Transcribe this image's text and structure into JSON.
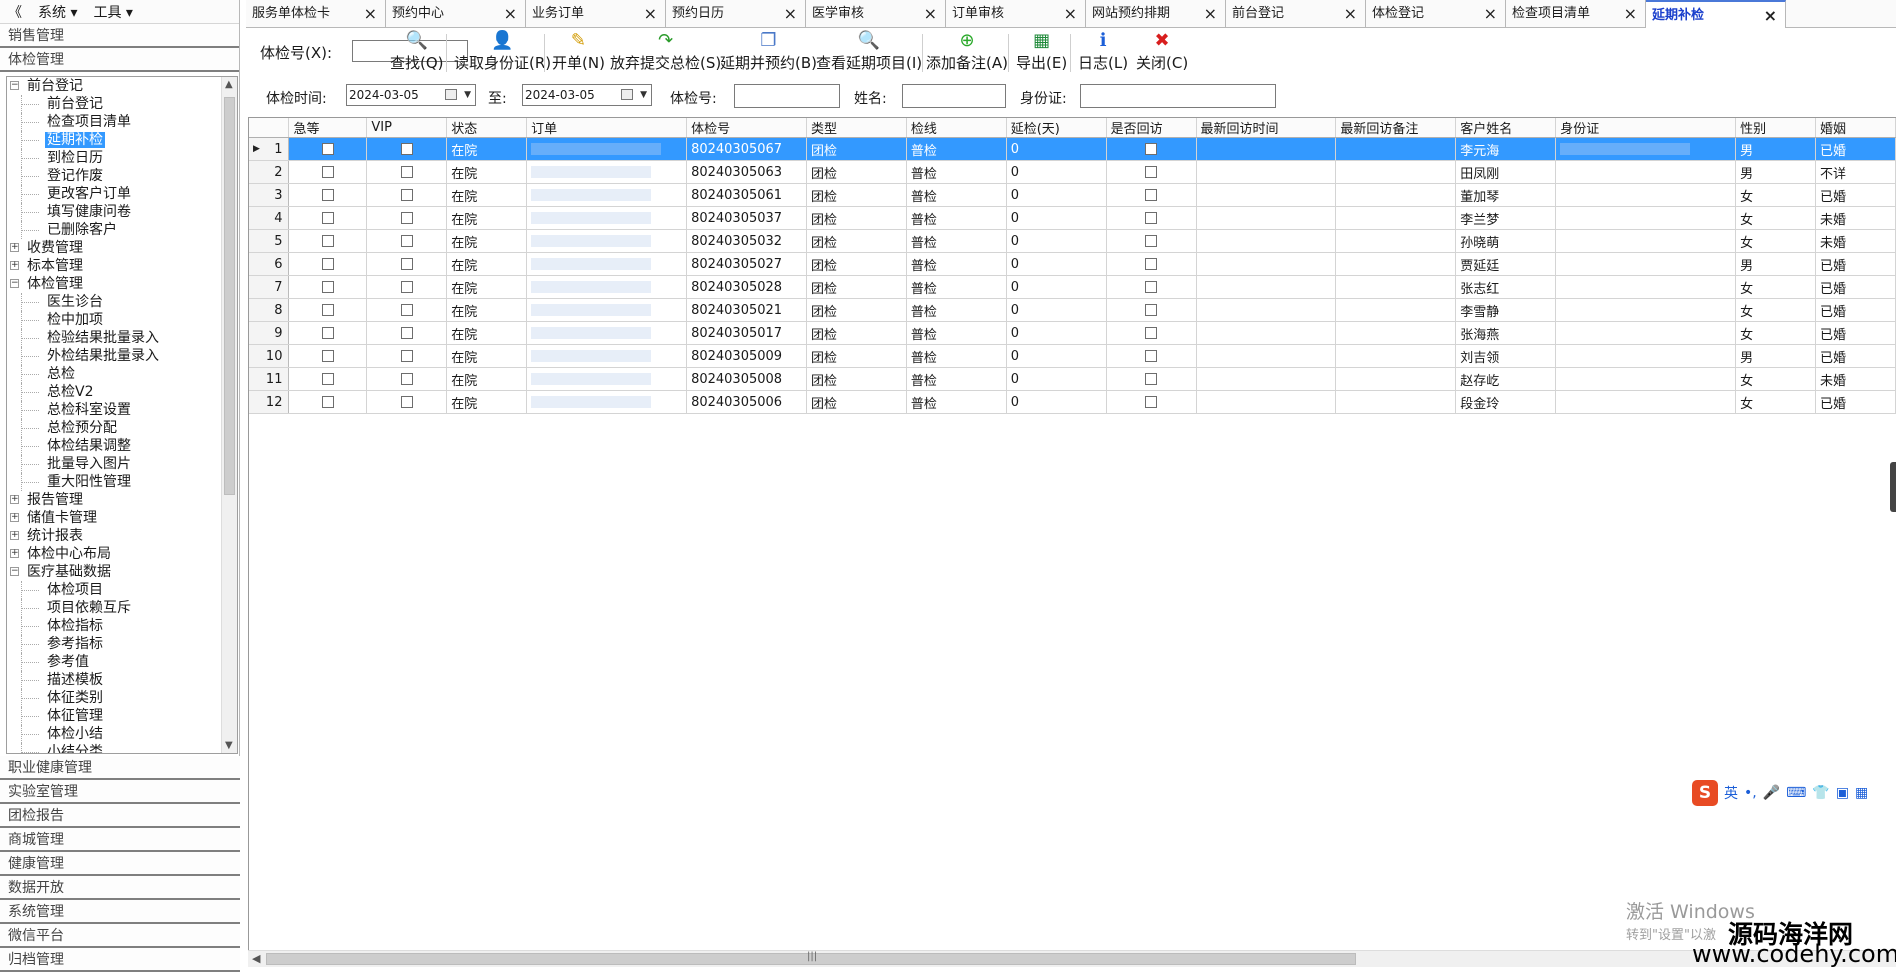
{
  "menu": {
    "collapse": "《",
    "system": "系统",
    "tools": "工具"
  },
  "left_nav": {
    "top_headers": [
      "销售管理",
      "体检管理"
    ],
    "tree": [
      {
        "label": "前台登记",
        "level": 1,
        "expander": "−"
      },
      {
        "label": "前台登记",
        "level": 2
      },
      {
        "label": "检查项目清单",
        "level": 2
      },
      {
        "label": "延期补检",
        "level": 2,
        "selected": true
      },
      {
        "label": "到检日历",
        "level": 2
      },
      {
        "label": "登记作废",
        "level": 2
      },
      {
        "label": "更改客户订单",
        "level": 2
      },
      {
        "label": "填写健康问卷",
        "level": 2
      },
      {
        "label": "已删除客户",
        "level": 2
      },
      {
        "label": "收费管理",
        "level": 1,
        "expander": "+"
      },
      {
        "label": "标本管理",
        "level": 1,
        "expander": "+"
      },
      {
        "label": "体检管理",
        "level": 1,
        "expander": "−"
      },
      {
        "label": "医生诊台",
        "level": 2
      },
      {
        "label": "检中加项",
        "level": 2
      },
      {
        "label": "检验结果批量录入",
        "level": 2
      },
      {
        "label": "外检结果批量录入",
        "level": 2
      },
      {
        "label": "总检",
        "level": 2
      },
      {
        "label": "总检V2",
        "level": 2
      },
      {
        "label": "总检科室设置",
        "level": 2
      },
      {
        "label": "总检预分配",
        "level": 2
      },
      {
        "label": "体检结果调整",
        "level": 2
      },
      {
        "label": "批量导入图片",
        "level": 2
      },
      {
        "label": "重大阳性管理",
        "level": 2
      },
      {
        "label": "报告管理",
        "level": 1,
        "expander": "+"
      },
      {
        "label": "储值卡管理",
        "level": 1,
        "expander": "+"
      },
      {
        "label": "统计报表",
        "level": 1,
        "expander": "+"
      },
      {
        "label": "体检中心布局",
        "level": 1,
        "expander": "+"
      },
      {
        "label": "医疗基础数据",
        "level": 1,
        "expander": "−"
      },
      {
        "label": "体检项目",
        "level": 2
      },
      {
        "label": "项目依赖互斥",
        "level": 2
      },
      {
        "label": "体检指标",
        "level": 2
      },
      {
        "label": "参考指标",
        "level": 2
      },
      {
        "label": "参考值",
        "level": 2
      },
      {
        "label": "描述模板",
        "level": 2
      },
      {
        "label": "体征类别",
        "level": 2
      },
      {
        "label": "体征管理",
        "level": 2
      },
      {
        "label": "体检小结",
        "level": 2
      },
      {
        "label": "小结分类",
        "level": 2
      }
    ],
    "bottom_headers": [
      "职业健康管理",
      "实验室管理",
      "团检报告",
      "商城管理",
      "健康管理",
      "数据开放",
      "系统管理",
      "微信平台",
      "归档管理"
    ]
  },
  "tabs": [
    {
      "label": "服务单体检卡"
    },
    {
      "label": "预约中心"
    },
    {
      "label": "业务订单"
    },
    {
      "label": "预约日历"
    },
    {
      "label": "医学审核"
    },
    {
      "label": "订单审核"
    },
    {
      "label": "网站预约排期"
    },
    {
      "label": "前台登记"
    },
    {
      "label": "体检登记"
    },
    {
      "label": "检查项目清单"
    },
    {
      "label": "延期补检",
      "active": true
    }
  ],
  "toolbar": {
    "search_label": "体检号(X):",
    "search_value": "",
    "buttons": [
      {
        "label": "查找(Q)",
        "icon": "magnifier-icon",
        "glyph": "🔍"
      },
      {
        "label": "读取身份证(R)",
        "icon": "id-card-reader-icon",
        "glyph": "👤"
      },
      {
        "label": "开单(N)",
        "icon": "edit-icon",
        "glyph": "✎"
      },
      {
        "label": "放弃提交总检(S)",
        "icon": "green-arrow-icon",
        "glyph": "↷"
      },
      {
        "label": "延期并预约(B)",
        "icon": "copy-icon",
        "glyph": "❐"
      },
      {
        "label": "查看延期项目(I)",
        "icon": "search-doc-icon",
        "glyph": "🔍"
      },
      {
        "label": "添加备注(A)",
        "icon": "green-plus-icon",
        "glyph": "⊕"
      },
      {
        "label": "导出(E)",
        "icon": "excel-icon",
        "glyph": "▦"
      },
      {
        "label": "日志(L)",
        "icon": "info-icon",
        "glyph": "ℹ"
      },
      {
        "label": "关闭(C)",
        "icon": "red-x-icon",
        "glyph": "✖"
      }
    ]
  },
  "filters": {
    "time_label": "体检时间:",
    "date_from": "2024-03-05",
    "to_label": "至:",
    "date_to": "2024-03-05",
    "exam_no_label": "体检号:",
    "exam_no_value": "",
    "name_label": "姓名:",
    "name_value": "",
    "id_label": "身份证:",
    "id_value": ""
  },
  "grid": {
    "columns": [
      "急等",
      "VIP",
      "状态",
      "订单",
      "体检号",
      "类型",
      "检线",
      "延检(天)",
      "是否回访",
      "最新回访时间",
      "最新回访备注",
      "客户姓名",
      "身份证",
      "性别",
      "婚姻"
    ],
    "rows": [
      {
        "n": "1",
        "status": "在院",
        "exam_no": "80240305067",
        "type": "团检",
        "line": "普检",
        "delay": "0",
        "name": "李元海",
        "sex": "男",
        "marital": "已婚"
      },
      {
        "n": "2",
        "status": "在院",
        "exam_no": "80240305063",
        "type": "团检",
        "line": "普检",
        "delay": "0",
        "name": "田凤刚",
        "sex": "男",
        "marital": "不详"
      },
      {
        "n": "3",
        "status": "在院",
        "exam_no": "80240305061",
        "type": "团检",
        "line": "普检",
        "delay": "0",
        "name": "董加琴",
        "sex": "女",
        "marital": "已婚"
      },
      {
        "n": "4",
        "status": "在院",
        "exam_no": "80240305037",
        "type": "团检",
        "line": "普检",
        "delay": "0",
        "name": "李兰梦",
        "sex": "女",
        "marital": "未婚"
      },
      {
        "n": "5",
        "status": "在院",
        "exam_no": "80240305032",
        "type": "团检",
        "line": "普检",
        "delay": "0",
        "name": "孙晓萌",
        "sex": "女",
        "marital": "未婚"
      },
      {
        "n": "6",
        "status": "在院",
        "exam_no": "80240305027",
        "type": "团检",
        "line": "普检",
        "delay": "0",
        "name": "贾延廷",
        "sex": "男",
        "marital": "已婚"
      },
      {
        "n": "7",
        "status": "在院",
        "exam_no": "80240305028",
        "type": "团检",
        "line": "普检",
        "delay": "0",
        "name": "张志红",
        "sex": "女",
        "marital": "已婚"
      },
      {
        "n": "8",
        "status": "在院",
        "exam_no": "80240305021",
        "type": "团检",
        "line": "普检",
        "delay": "0",
        "name": "李雪静",
        "sex": "女",
        "marital": "已婚"
      },
      {
        "n": "9",
        "status": "在院",
        "exam_no": "80240305017",
        "type": "团检",
        "line": "普检",
        "delay": "0",
        "name": "张海燕",
        "sex": "女",
        "marital": "已婚"
      },
      {
        "n": "10",
        "status": "在院",
        "exam_no": "80240305009",
        "type": "团检",
        "line": "普检",
        "delay": "0",
        "name": "刘吉领",
        "sex": "男",
        "marital": "已婚"
      },
      {
        "n": "11",
        "status": "在院",
        "exam_no": "80240305008",
        "type": "团检",
        "line": "普检",
        "delay": "0",
        "name": "赵存屹",
        "sex": "女",
        "marital": "未婚"
      },
      {
        "n": "12",
        "status": "在院",
        "exam_no": "80240305006",
        "type": "团检",
        "line": "普检",
        "delay": "0",
        "name": "段金玲",
        "sex": "女",
        "marital": "已婚"
      }
    ]
  },
  "overlays": {
    "ime_logo": "S",
    "ime_lang": "英",
    "win_activate_1": "激活 Windows",
    "win_activate_2": "转到\"设置\"以激",
    "site_name": "源码海洋网",
    "site_url": "www.codehy.com"
  },
  "colors": {
    "selection": "#3399ff",
    "active_tab_text": "#1a3fcc"
  }
}
